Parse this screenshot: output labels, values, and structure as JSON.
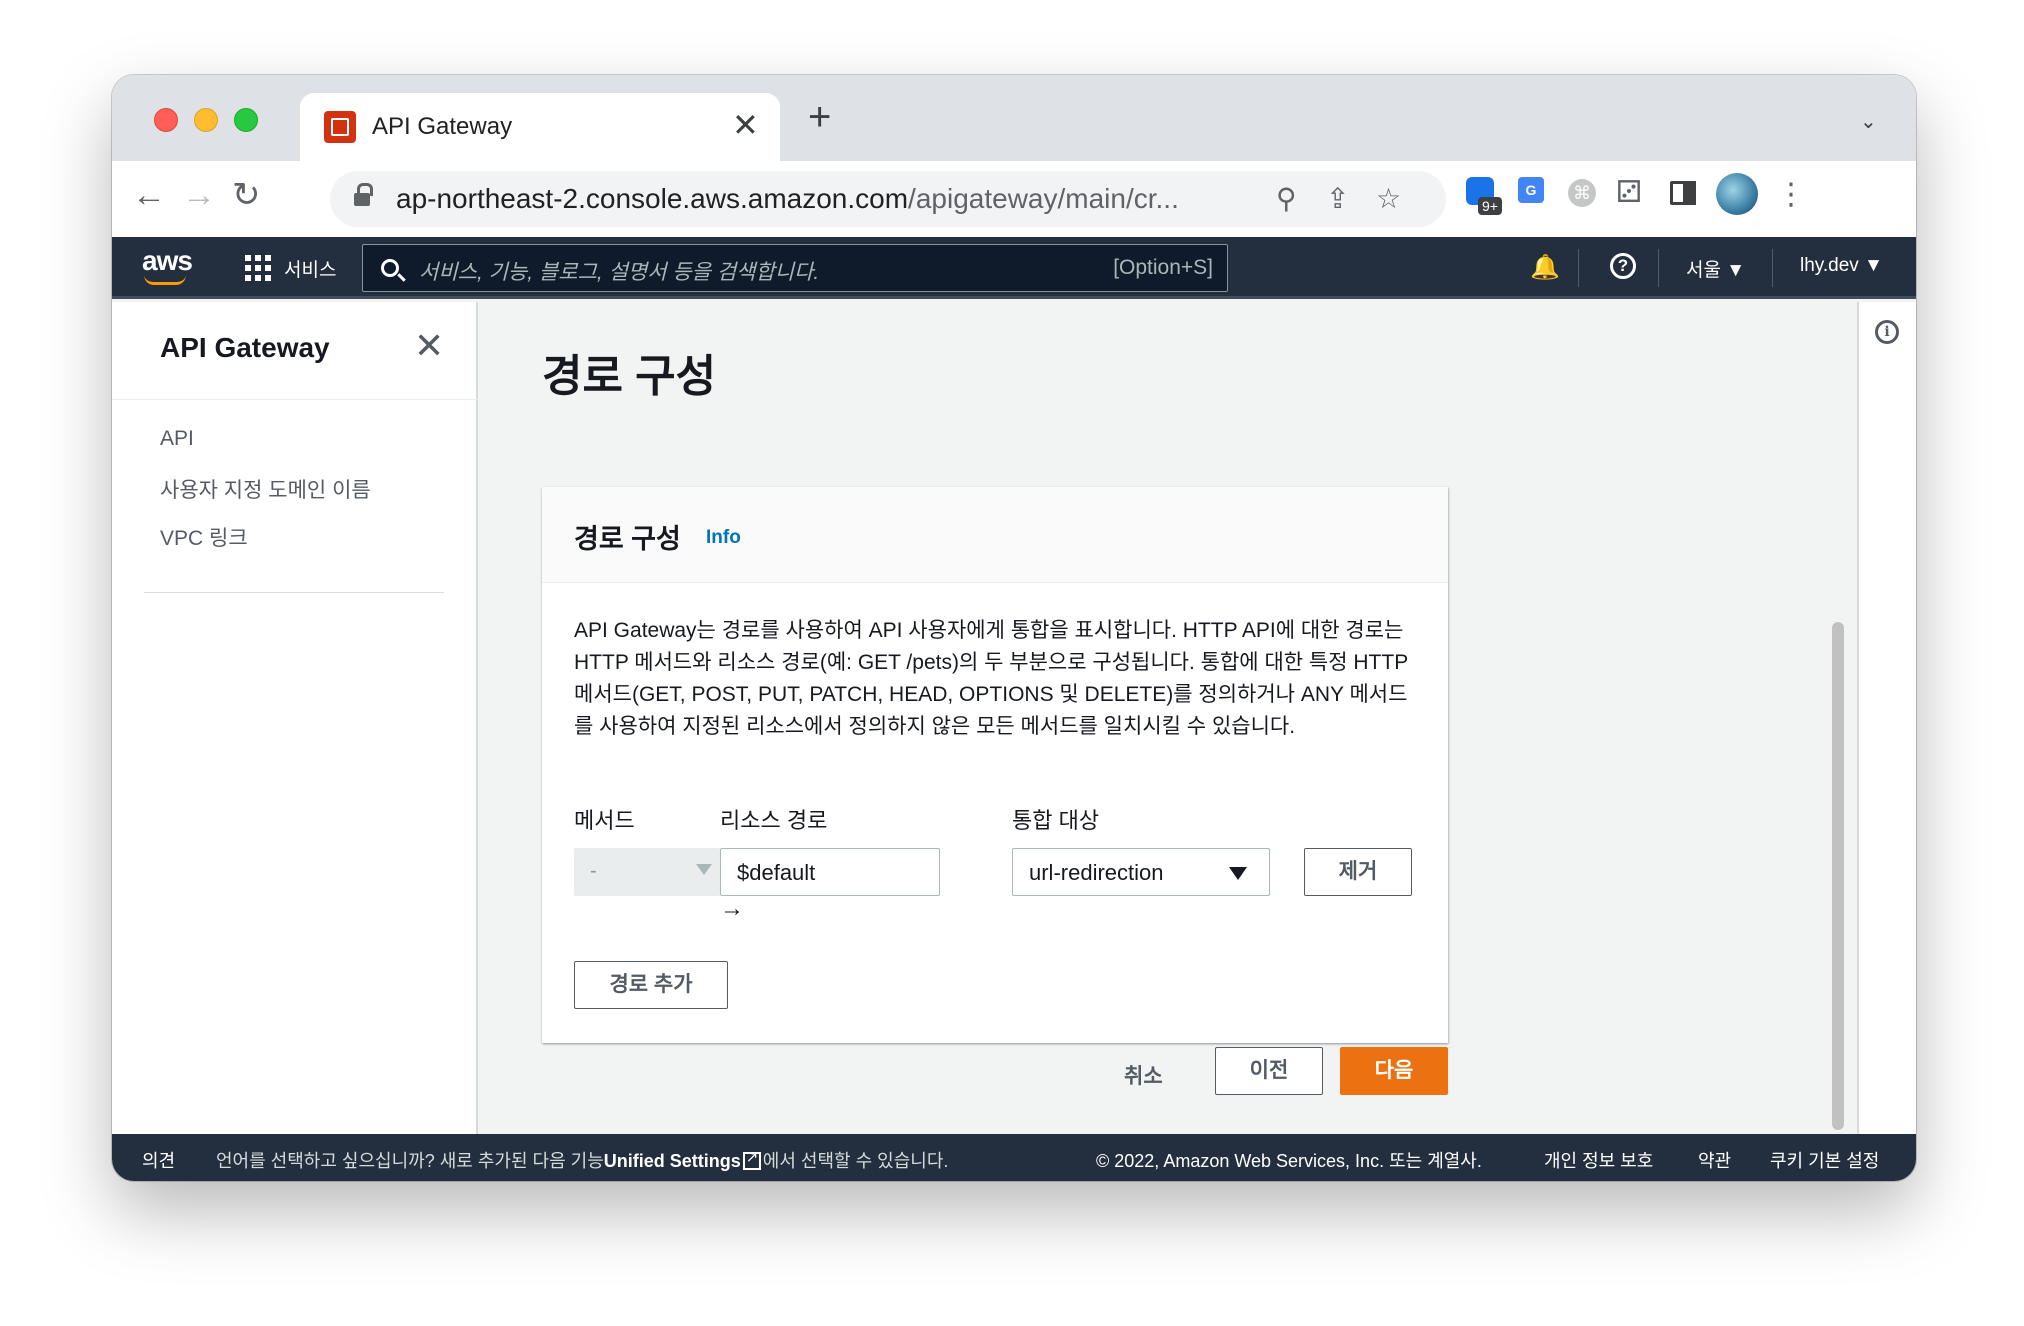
{
  "browser": {
    "tab_title": "API Gateway",
    "tab_close": "✕",
    "new_tab": "+",
    "url_host": "ap-northeast-2.console.aws.amazon.com",
    "url_path": "/apigateway/main/cr...",
    "extension_badge": "9+",
    "icons": [
      "back-icon",
      "forward-icon",
      "reload-icon",
      "lock-icon",
      "zoom-out-icon",
      "share-icon",
      "star-icon",
      "extensions-icon",
      "side-panel-icon",
      "profile-avatar",
      "more-icon"
    ]
  },
  "aws_nav": {
    "services_label": "서비스",
    "search_placeholder": "서비스, 기능, 블로그, 설명서 등을 검색합니다.",
    "search_shortcut": "[Option+S]",
    "region": "서울 ▼",
    "account": "lhy.dev ▼"
  },
  "sidebar": {
    "title": "API Gateway",
    "items": [
      {
        "label": "API"
      },
      {
        "label": "사용자 지정 도메인 이름"
      },
      {
        "label": "VPC 링크"
      }
    ]
  },
  "main": {
    "page_title": "경로 구성",
    "container": {
      "title": "경로 구성",
      "info_link": "Info",
      "description": "API Gateway는 경로를 사용하여 API 사용자에게 통합을 표시합니다. HTTP API에 대한 경로는 HTTP 메서드와 리소스 경로(예: GET /pets)의 두 부분으로 구성됩니다. 통합에 대한 특정 HTTP 메서드(GET, POST, PUT, PATCH, HEAD, OPTIONS 및 DELETE)를 정의하거나 ANY 메서드를 사용하여 지정된 리소스에서 정의하지 않은 모든 메서드를 일치시킬 수 있습니다.",
      "labels": {
        "method": "메서드",
        "resource_path": "리소스 경로",
        "integration_target": "통합 대상"
      },
      "route": {
        "method_value": "-",
        "resource_path_value": "$default",
        "arrow": "→",
        "integration_value": "url-redirection",
        "remove_label": "제거"
      },
      "add_route_label": "경로 추가"
    },
    "actions": {
      "cancel": "취소",
      "previous": "이전",
      "next": "다음"
    }
  },
  "footer": {
    "feedback": "의견",
    "language_notice_pre": "언어를 선택하고 싶으십니까? 새로 추가된 다음 기능",
    "unified_settings": "Unified Settings",
    "language_notice_post": "에서 선택할 수 있습니다.",
    "copyright": "© 2022, Amazon Web Services, Inc. 또는 계열사.",
    "privacy": "개인 정보 보호",
    "terms": "약관",
    "cookies": "쿠키 기본 설정"
  },
  "colors": {
    "aws_nav_bg": "#232f3e",
    "primary_button": "#ec7211",
    "info_link": "#0073bb",
    "page_bg": "#f2f3f3"
  }
}
